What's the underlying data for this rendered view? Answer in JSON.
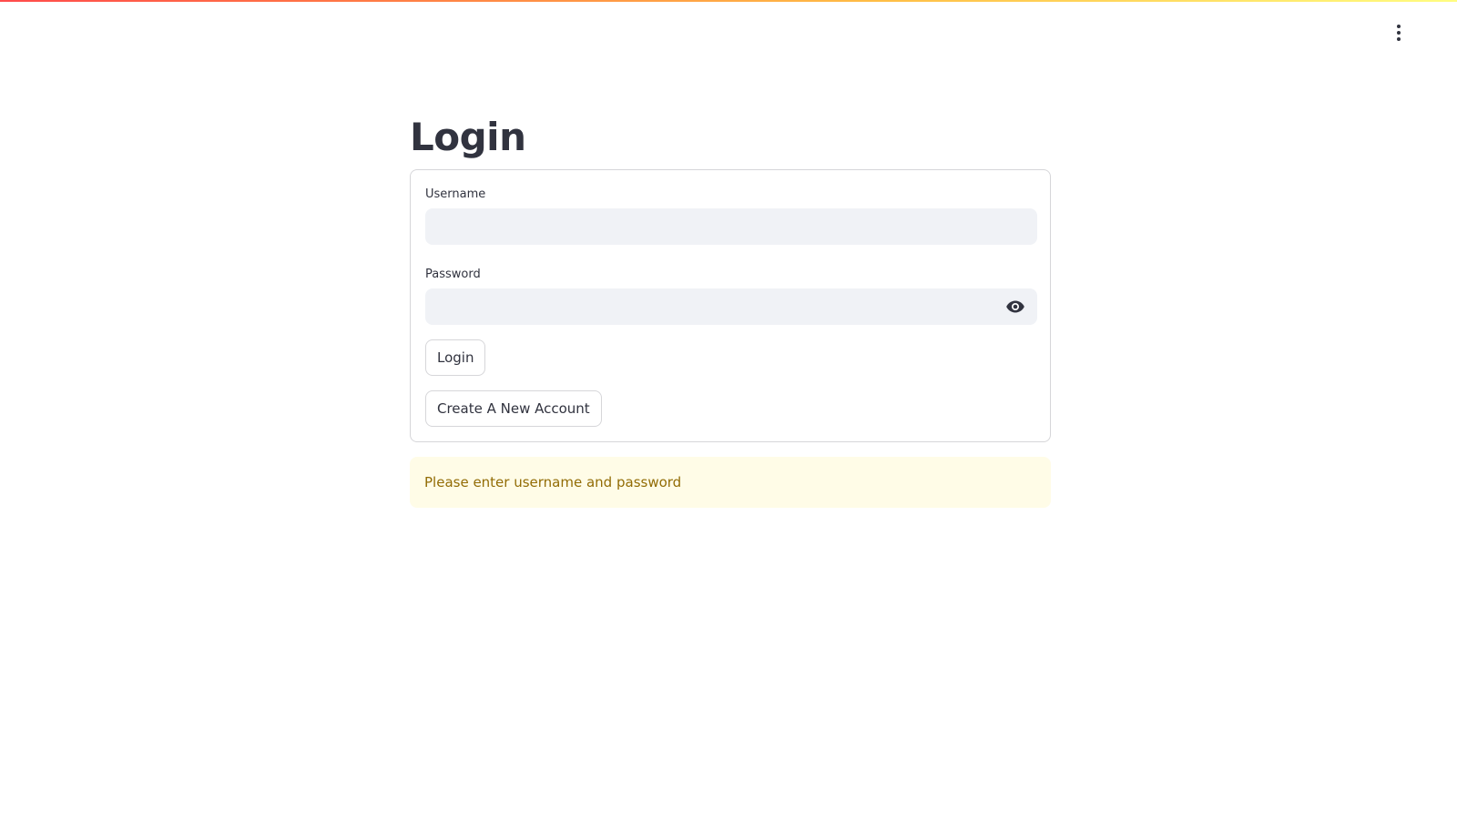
{
  "app": {
    "decoration_gradient": [
      "#ff4b4b",
      "#ffbd45",
      "#fffd80"
    ],
    "main_menu_icon": "vertical-ellipsis-icon"
  },
  "page": {
    "title": "Login"
  },
  "form": {
    "username": {
      "label": "Username",
      "value": "",
      "placeholder": ""
    },
    "password": {
      "label": "Password",
      "value": "",
      "placeholder": "",
      "toggle_icon": "eye-icon"
    },
    "login_button_label": "Login",
    "create_account_button_label": "Create A New Account"
  },
  "alert": {
    "type": "warning",
    "message": "Please enter username and password",
    "background": "#fffce7",
    "text_color": "#926c05"
  }
}
